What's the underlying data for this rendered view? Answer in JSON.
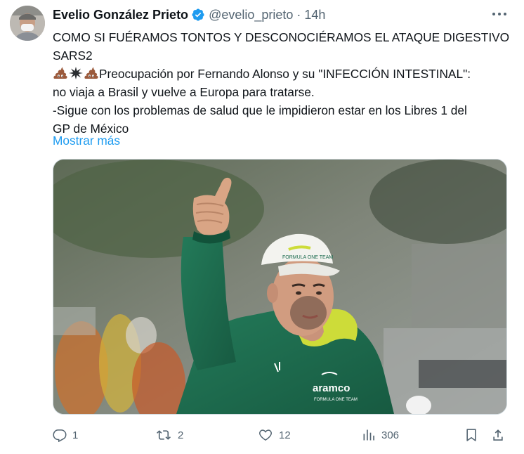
{
  "author": {
    "name": "Evelio González Prieto",
    "handle": "@evelio_prieto",
    "separator": "·",
    "time": "14h"
  },
  "tweet": {
    "line1": "COMO SI FUÉRAMOS TONTOS Y DESCONOCIÉRAMOS EL ATAQUE DIGESTIVO",
    "line2": "SARS2",
    "line3": "Preocupación por Fernando Alonso y su \"INFECCIÓN INTESTINAL\":",
    "line4": "no viaja a Brasil y vuelve a Europa para tratarse.",
    "line5": "-Sigue con los problemas de salud que le impidieron estar en los Libres 1 del",
    "line6": "GP de México",
    "show_more": "Mostrar más",
    "emojis": [
      "pile-of-poo-icon",
      "collision-icon",
      "pile-of-poo-icon"
    ]
  },
  "media": {
    "cap_brand": "FORMULA ONE TEAM",
    "jacket_brand": "aramco",
    "jacket_sub": "FORMULA ONE TEAM"
  },
  "actions": {
    "replies": "1",
    "reposts": "2",
    "likes": "12",
    "views": "306"
  },
  "colors": {
    "accent": "#1d9bf0",
    "text": "#0f1419",
    "muted": "#536471",
    "jacket_green": "#1c6b4f",
    "lime": "#cddc39"
  }
}
